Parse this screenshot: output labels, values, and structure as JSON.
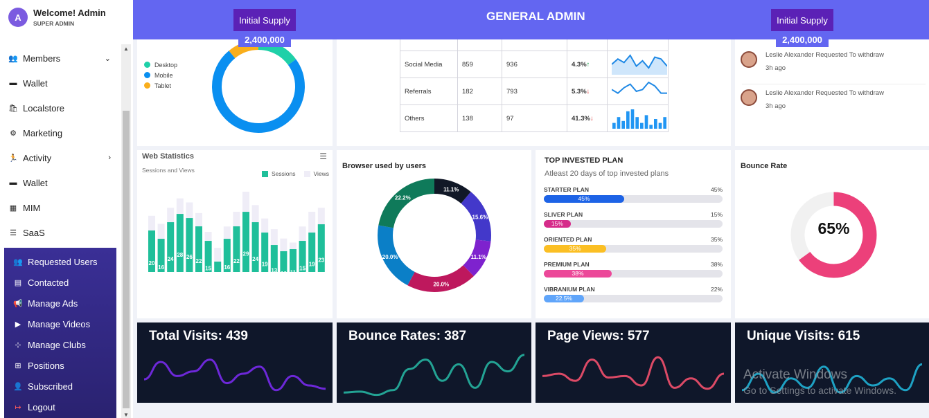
{
  "user": {
    "avatar_letter": "A",
    "welcome": "Welcome! Admin",
    "role": "SUPER ADMIN"
  },
  "menu": [
    {
      "icon": "users-icon",
      "glyph": "👥",
      "label": "Members",
      "chevron": "⌄"
    },
    {
      "icon": "wallet-icon",
      "glyph": "▬",
      "label": "Wallet",
      "chevron": ""
    },
    {
      "icon": "bag-icon",
      "glyph": "🛍",
      "label": "Localstore",
      "chevron": ""
    },
    {
      "icon": "gear-icon",
      "glyph": "⚙",
      "label": "Marketing",
      "chevron": ""
    },
    {
      "icon": "running-icon",
      "glyph": "🏃",
      "label": "Activity",
      "chevron": "›"
    },
    {
      "icon": "wallet-icon",
      "glyph": "▬",
      "label": "Wallet",
      "chevron": ""
    },
    {
      "icon": "calendar-icon",
      "glyph": "▦",
      "label": "MIM",
      "chevron": ""
    },
    {
      "icon": "list-icon",
      "glyph": "☰",
      "label": "SaaS",
      "chevron": ""
    }
  ],
  "submenu": [
    {
      "icon": "users-icon",
      "glyph": "👥",
      "label": "Requested Users"
    },
    {
      "icon": "card-icon",
      "glyph": "▤",
      "label": "Contacted"
    },
    {
      "icon": "megaphone-icon",
      "glyph": "📢",
      "label": "Manage Ads"
    },
    {
      "icon": "video-icon",
      "glyph": "▶",
      "label": "Manage Videos"
    },
    {
      "icon": "sitemap-icon",
      "glyph": "⊹",
      "label": "Manage Clubs"
    },
    {
      "icon": "sitemap-icon",
      "glyph": "⊞",
      "label": "Positions"
    },
    {
      "icon": "user-icon",
      "glyph": "👤",
      "label": "Subscribed"
    },
    {
      "icon": "logout-icon",
      "glyph": "↦",
      "label": "Logout"
    }
  ],
  "header": {
    "title": "GENERAL ADMIN",
    "supply_label": "Initial Supply",
    "supply_value": "2,400,000"
  },
  "device_legend": [
    {
      "label": "Desktop",
      "color": "#1fd0a8",
      "value": 15
    },
    {
      "label": "Mobile",
      "color": "#0a8ff0",
      "value": 74
    },
    {
      "label": "Tablet",
      "color": "#f9ae1c",
      "value": 11
    }
  ],
  "traffic": [
    {
      "source": "Social Media",
      "a": "859",
      "b": "936",
      "pct": "4.3%",
      "arrow": "↑",
      "dir": "up",
      "spark": [
        5,
        8,
        6,
        10,
        4,
        7,
        3,
        9,
        8,
        4
      ]
    },
    {
      "source": "Referrals",
      "a": "182",
      "b": "793",
      "pct": "5.3%",
      "arrow": "↓",
      "dir": "down",
      "spark": [
        6,
        4,
        7,
        9,
        5,
        6,
        10,
        8,
        4,
        4
      ]
    },
    {
      "source": "Others",
      "a": "138",
      "b": "97",
      "pct": "41.3%",
      "arrow": "↓",
      "dir": "down",
      "spark": [
        3,
        6,
        4,
        9,
        10,
        6,
        3,
        7,
        2,
        5,
        3,
        6
      ]
    }
  ],
  "notifications": [
    {
      "text": "Leslie Alexander Requested To withdraw",
      "time": "3h ago"
    },
    {
      "text": "Leslie Alexander Requested To withdraw",
      "time": "3h ago"
    }
  ],
  "web_stats": {
    "title": "Web Statistics",
    "subtitle": "Sessions and Views",
    "legend": [
      "Sessions",
      "Views"
    ],
    "menu_glyph": "☰",
    "chart_data": {
      "type": "bar",
      "series": [
        {
          "name": "Sessions",
          "values": [
            20,
            16,
            24,
            28,
            26,
            22,
            15,
            5,
            16,
            22,
            29,
            24,
            19,
            13,
            10,
            11,
            15,
            19,
            23
          ]
        },
        {
          "name": "Views",
          "values": [
            42,
            36,
            48,
            55,
            52,
            44,
            30,
            18,
            34,
            45,
            60,
            50,
            40,
            32,
            25,
            22,
            34,
            45,
            48
          ]
        }
      ],
      "sessions_color": "#1fbf9a",
      "views_color": "#efedf7"
    }
  },
  "browser": {
    "title": "Browser used by users",
    "chart_data": {
      "type": "pie",
      "values": [
        11.1,
        15.6,
        11.1,
        20.0,
        20.0,
        22.2
      ],
      "labels": [
        "11.1%",
        "15.6%",
        "11.1%",
        "20.0%",
        "20.0%",
        "22.2%"
      ],
      "colors": [
        "#111827",
        "#4338ca",
        "#7e22ce",
        "#be185d",
        "#0b7fc7",
        "#0f7a5a"
      ]
    }
  },
  "plans": {
    "title": "TOP INVESTED PLAN",
    "subtitle": "Atleast 20 days of top invested plans",
    "items": [
      {
        "name": "STARTER PLAN",
        "pct_label": "45%",
        "value": 45,
        "color": "#1d63e6"
      },
      {
        "name": "SLIVER PLAN",
        "pct_label": "15%",
        "value": 15,
        "color": "#d62c8a"
      },
      {
        "name": "ORIENTED PLAN",
        "pct_label": "35%",
        "value": 35,
        "color": "#fbbf24"
      },
      {
        "name": "PREMIUM PLAN",
        "pct_label": "38%",
        "value": 38,
        "color": "#ec4899"
      },
      {
        "name": "VIBRANIUM PLAN",
        "pct_label": "22%",
        "value": 22.5,
        "inner_label": "22.5%",
        "color": "#60a5fa"
      }
    ]
  },
  "bounce": {
    "title": "Bounce Rate",
    "value_label": "65%",
    "value": 65,
    "color": "#ec407a"
  },
  "stats": [
    {
      "title": "Total Visits: 439",
      "color": "#6d28d9",
      "points": [
        0.62,
        0.25,
        0.55,
        0.45,
        0.2,
        0.7,
        0.5,
        0.35,
        0.85,
        0.55,
        0.75,
        0.82
      ]
    },
    {
      "title": "Bounce Rates: 387",
      "color": "#23a394",
      "points": [
        0.9,
        0.88,
        0.95,
        0.85,
        0.4,
        0.2,
        0.65,
        0.3,
        0.8,
        0.25,
        0.45,
        0.1
      ]
    },
    {
      "title": "Page Views: 577",
      "color": "#dc4a66",
      "points": [
        0.55,
        0.5,
        0.65,
        0.2,
        0.58,
        0.55,
        0.75,
        0.15,
        0.8,
        0.6,
        0.82,
        0.5
      ]
    },
    {
      "title": "Unique Visits: 615",
      "color": "#1ea2c4",
      "points": [
        0.85,
        0.5,
        0.9,
        0.6,
        0.8,
        0.35,
        0.9,
        0.55,
        0.75,
        0.6,
        0.85,
        0.3
      ]
    }
  ],
  "watermark": {
    "line1": "Activate Windows",
    "line2": "Go to Settings to activate Windows."
  }
}
